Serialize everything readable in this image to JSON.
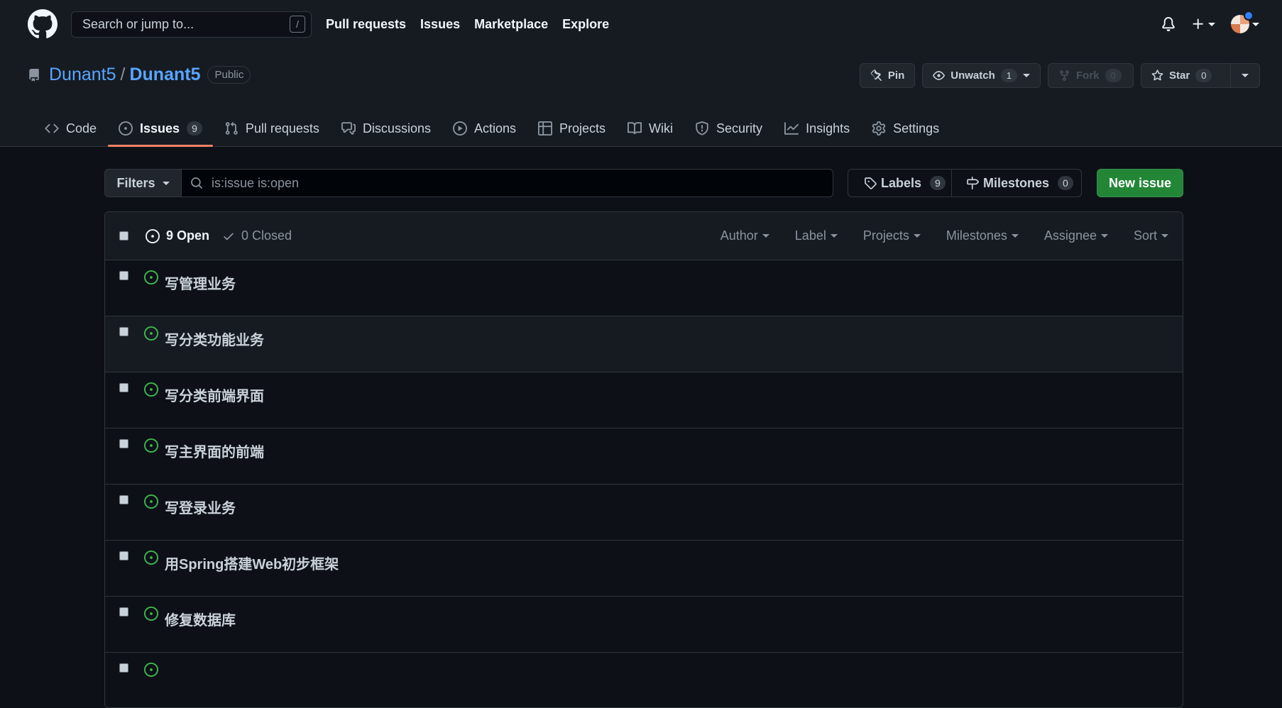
{
  "header": {
    "search_placeholder": "Search or jump to...",
    "search_shortcut": "/",
    "nav": [
      "Pull requests",
      "Issues",
      "Marketplace",
      "Explore"
    ]
  },
  "repo": {
    "owner": "Dunant5",
    "separator": "/",
    "name": "Dunant5",
    "visibility": "Public",
    "actions": {
      "pin": "Pin",
      "unwatch": "Unwatch",
      "unwatch_count": "1",
      "fork": "Fork",
      "fork_count": "0",
      "star": "Star",
      "star_count": "0"
    }
  },
  "tabs": [
    {
      "label": "Code",
      "icon": "code-icon"
    },
    {
      "label": "Issues",
      "icon": "issue-opened-icon",
      "count": "9",
      "active": true
    },
    {
      "label": "Pull requests",
      "icon": "git-pull-request-icon"
    },
    {
      "label": "Discussions",
      "icon": "comment-discussion-icon"
    },
    {
      "label": "Actions",
      "icon": "play-icon"
    },
    {
      "label": "Projects",
      "icon": "table-icon"
    },
    {
      "label": "Wiki",
      "icon": "book-icon"
    },
    {
      "label": "Security",
      "icon": "shield-icon"
    },
    {
      "label": "Insights",
      "icon": "graph-icon"
    },
    {
      "label": "Settings",
      "icon": "gear-icon"
    }
  ],
  "subnav": {
    "filters_label": "Filters",
    "query": "is:issue is:open",
    "labels_label": "Labels",
    "labels_count": "9",
    "milestones_label": "Milestones",
    "milestones_count": "0",
    "new_issue_label": "New issue"
  },
  "issues_header": {
    "open_label": "9 Open",
    "closed_label": "0 Closed",
    "sorters": [
      "Author",
      "Label",
      "Projects",
      "Milestones",
      "Assignee",
      "Sort"
    ]
  },
  "issues": [
    "写管理业务",
    "写分类功能业务",
    "写分类前端界面",
    "写主界面的前端",
    "写登录业务",
    "用Spring搭建Web初步框架",
    "修复数据库",
    ""
  ],
  "colors": {
    "bg": "#0d1117",
    "header_bg": "#161b22",
    "accent_link": "#58a6ff",
    "open_green": "#3fb950",
    "new_issue_green": "#238636",
    "active_tab_underline": "#f78166"
  }
}
